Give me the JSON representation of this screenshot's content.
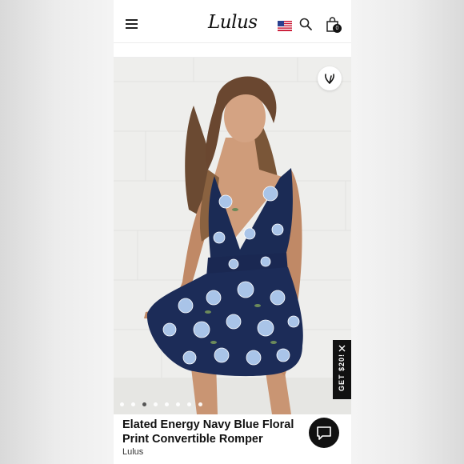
{
  "header": {
    "logo_text": "Lulus",
    "menu_icon": "hamburger-icon",
    "flag_icon": "us-flag-icon",
    "search_icon": "search-icon",
    "bag_icon": "shopping-bag-icon",
    "bag_count": "0"
  },
  "product": {
    "title": "Elated Energy Navy Blue Floral Print Convertible Romper",
    "brand": "Lulus",
    "image_dots_total": 8,
    "image_dots_active": 3
  },
  "overlays": {
    "wishlist_icon": "heart-icon",
    "promo_label": "GET $20!",
    "promo_close_icon": "close-icon",
    "chat_icon": "chat-bubble-icon"
  },
  "colors": {
    "romper_navy": "#1b2b55",
    "flower_blue": "#a9c4e8",
    "background_wall": "#eeeeec"
  }
}
